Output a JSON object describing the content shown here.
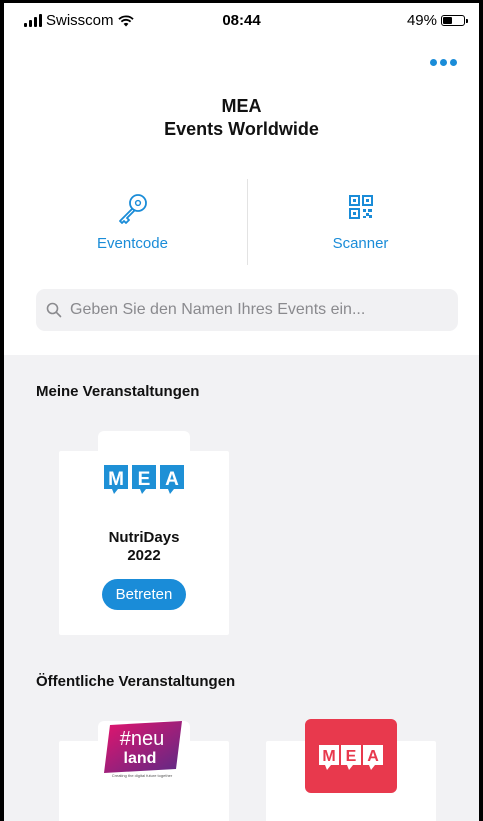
{
  "status_bar": {
    "carrier": "Swisscom",
    "time": "08:44",
    "battery": "49%",
    "battery_level": 0.49
  },
  "header": {
    "app_name": "MEA",
    "subtitle": "Events Worldwide",
    "menu_icon": "more-dots-icon"
  },
  "actions": {
    "eventcode_label": "Eventcode",
    "eventcode_icon": "key-icon",
    "scanner_label": "Scanner",
    "scanner_icon": "qr-code-icon"
  },
  "search": {
    "placeholder": "Geben Sie den Namen Ihres Events ein...",
    "value": ""
  },
  "my_events": {
    "title": "Meine Veranstaltungen",
    "items": [
      {
        "logo_text": "MEA",
        "name_line1": "NutriDays",
        "name_line2": "2022",
        "button_label": "Betreten"
      }
    ]
  },
  "public_events": {
    "title": "Öffentliche Veranstaltungen",
    "items": [
      {
        "logo_text_1": "#neu",
        "logo_text_2": "land",
        "logo_tagline": "Creating the digital future together"
      },
      {
        "logo_text": "MEA"
      }
    ]
  },
  "colors": {
    "accent": "#1a8cd8",
    "mea_blue": "#1e90d6",
    "mea_red": "#e8394d",
    "neuland_pink": "#e4146d",
    "neuland_purple": "#5b2a86"
  }
}
